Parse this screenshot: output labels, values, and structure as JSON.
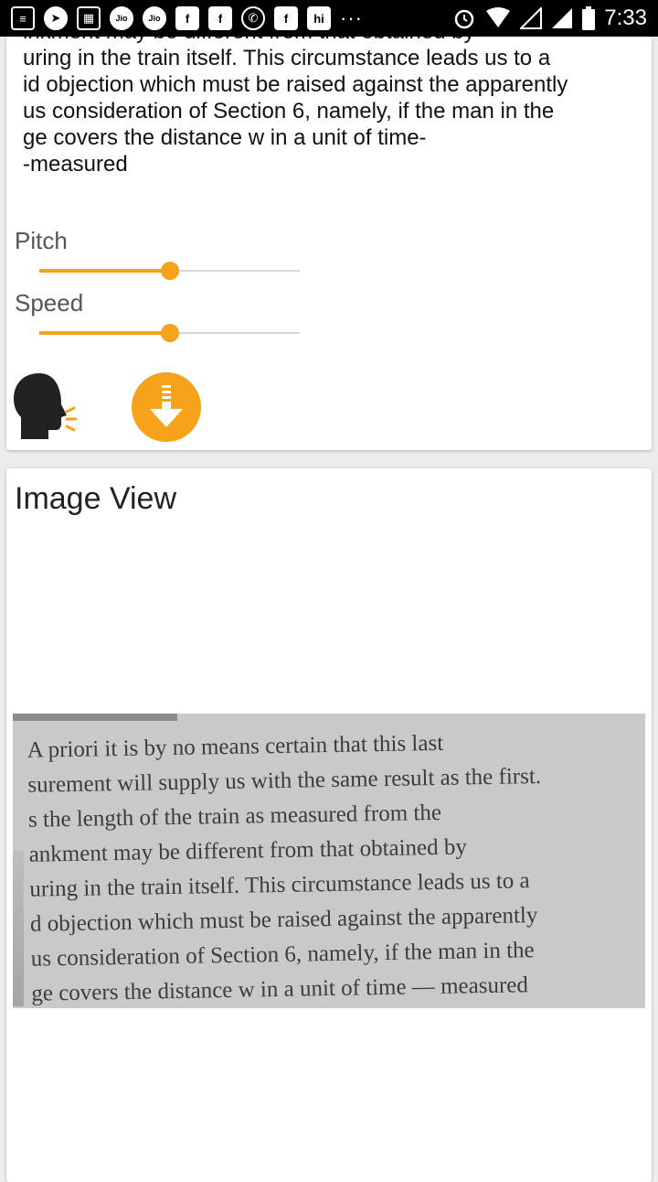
{
  "status_bar": {
    "time": "7:33",
    "icons": [
      "news-icon",
      "telegram-icon",
      "calendar-icon",
      "jio-icon",
      "jio-icon",
      "facebook-icon",
      "facebook-icon",
      "whatsapp-icon",
      "facebook-icon",
      "hike-icon",
      "more-icon",
      "alarm-icon",
      "wifi-icon",
      "signal-icon",
      "signal-icon",
      "battery-icon"
    ],
    "jio_label": "Jio",
    "hike_label": "hi",
    "facebook_label": "f",
    "more_label": "···"
  },
  "ocr": {
    "text": "inkment may be different from that obtained by\nuring in the train itself. This circumstance leads us to a\nid objection which must be raised against the apparently\nus consideration of Section 6, namely, if the man in the\nge covers the distance w in a unit of time-\n-measured"
  },
  "controls": {
    "pitch_label": "Pitch",
    "pitch_value": 0.5,
    "speed_label": "Speed",
    "speed_value": 0.5
  },
  "image_card": {
    "title": "Image View",
    "photo_text": "A priori it is by no means certain that this last\nsurement will supply us with the same result as the first.\ns the length of the train as measured from the\nankment may be different from that obtained by\nuring in the train itself. This circumstance leads us to a\nd objection which must be raised against the apparently\nus consideration of Section 6, namely, if the man in the\nge covers the distance w in a unit of time — measured"
  },
  "colors": {
    "accent": "#f7a21b",
    "track": "#d6d6d6",
    "icon_dark": "#222222"
  }
}
